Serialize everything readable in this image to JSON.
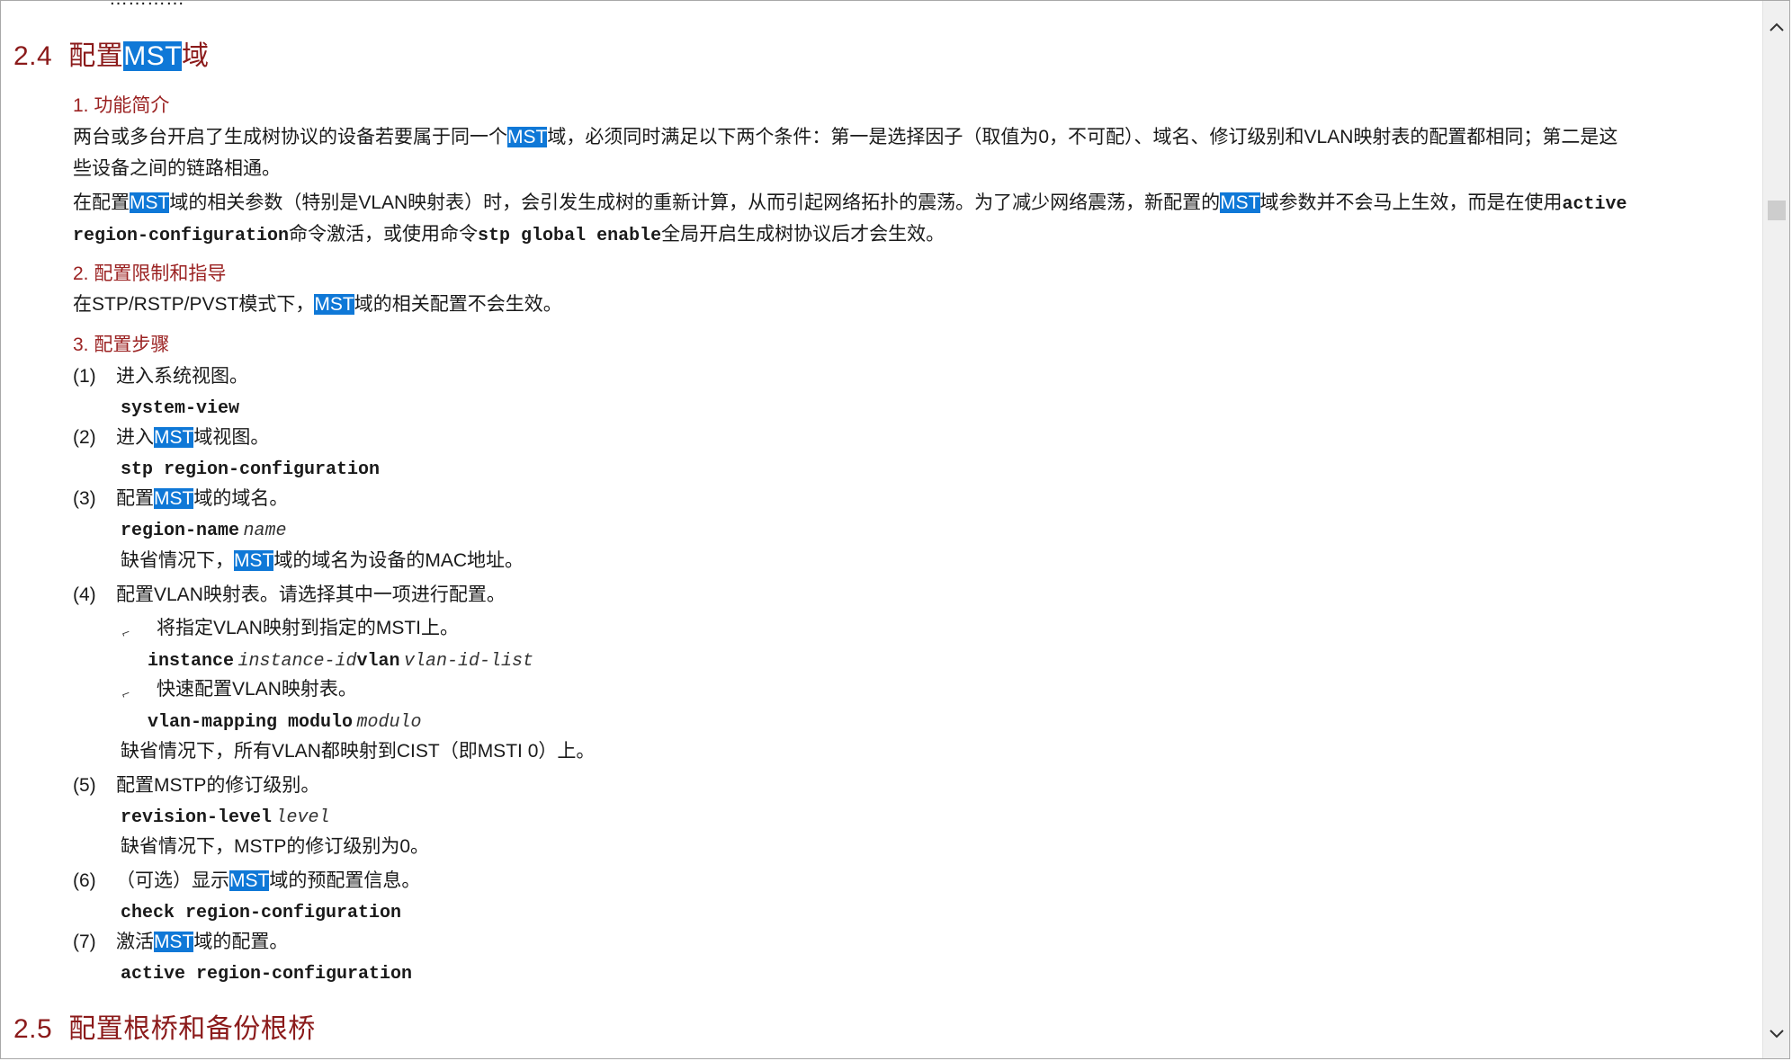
{
  "top_cut_text": "…………",
  "highlight": "MST",
  "sections": {
    "s24": {
      "num": "2.4",
      "title_pre": "配置",
      "title_post": "域"
    },
    "s25": {
      "num": "2.5",
      "title": "配置根桥和备份根桥"
    }
  },
  "sub": {
    "intro": "1. 功能简介",
    "limits": "2. 配置限制和指导",
    "steps": "3. 配置步骤"
  },
  "intro": {
    "l1_a": "两台或多台开启了生成树协议的设备若要属于同一个",
    "l1_b": "域，必须同时满足以下两个条件：第一是选择因子（取值为0，不可配）、域名、修订级别和VLAN映射表的配置都相同；第二是这",
    "l2": "些设备之间的链路相通。",
    "l3_a": "在配置",
    "l3_b": "域的相关参数（特别是VLAN映射表）时，会引发生成树的重新计算，从而引起网络拓扑的震荡。为了减少网络震荡，新配置的",
    "l3_c": "域参数并不会马上生效，而是在使用",
    "l3_cmd": "active",
    "l4_cmd1": "region-configuration",
    "l4_a": "命令激活，或使用命令",
    "l4_cmd2": "stp global enable",
    "l4_b": "全局开启生成树协议后才会生效。"
  },
  "limits": {
    "a": "在STP/RSTP/PVST模式下，",
    "b": "域的相关配置不会生效。"
  },
  "steps": {
    "s1": {
      "n": "(1)",
      "text": "进入系统视图。",
      "cmd": "system-view"
    },
    "s2": {
      "n": "(2)",
      "pre": "进入",
      "post": "域视图。",
      "cmd": "stp region-configuration"
    },
    "s3": {
      "n": "(3)",
      "pre": "配置",
      "post": "域的域名。",
      "cmd": "region-name",
      "arg": "name",
      "note_a": "缺省情况下，",
      "note_b": "域的域名为设备的MAC地址。"
    },
    "s4": {
      "n": "(4)",
      "text": "配置VLAN映射表。请选择其中一项进行配置。",
      "b1": "将指定VLAN映射到指定的MSTI上。",
      "b1_cmd1": "instance",
      "b1_arg1": "instance-id",
      "b1_cmd2": "vlan",
      "b1_arg2": "vlan-id-list",
      "b2": "快速配置VLAN映射表。",
      "b2_cmd": "vlan-mapping modulo",
      "b2_arg": "modulo",
      "note": "缺省情况下，所有VLAN都映射到CIST（即MSTI 0）上。"
    },
    "s5": {
      "n": "(5)",
      "text": "配置MSTP的修订级别。",
      "cmd": "revision-level",
      "arg": "level",
      "note": "缺省情况下，MSTP的修订级别为0。"
    },
    "s6": {
      "n": "(6)",
      "pre": "（可选）显示",
      "post": "域的预配置信息。",
      "cmd": "check region-configuration"
    },
    "s7": {
      "n": "(7)",
      "pre": "激活",
      "post": "域的配置。",
      "cmd": "active region-configuration"
    }
  },
  "bullet_glyph": "⌐",
  "icons": {
    "up": "chevron-up-icon",
    "down": "chevron-down-icon"
  }
}
